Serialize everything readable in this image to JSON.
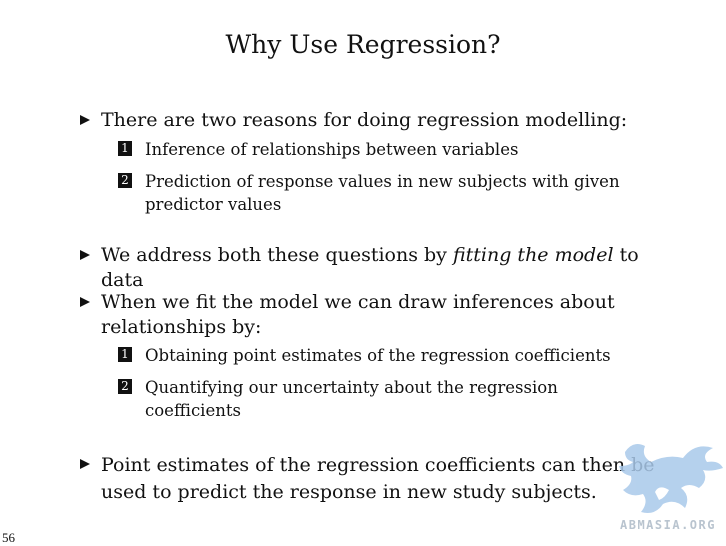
{
  "slide": {
    "title": "Why Use Regression?",
    "page_number": "56"
  },
  "bullets": [
    {
      "text": "There are two reasons for doing regression modelling:",
      "subitems": [
        {
          "num": "1",
          "text": "Inference of relationships between variables"
        },
        {
          "num": "2",
          "text": "Prediction of response values in new subjects with given predictor values"
        }
      ]
    },
    {
      "text_before": "We address both these questions by ",
      "text_italic": "fitting the model",
      "text_after": " to data"
    },
    {
      "text": "When we fit the model we can draw inferences about relationships by:",
      "subitems": [
        {
          "num": "1",
          "text": "Obtaining point estimates of the regression coefficients"
        },
        {
          "num": "2",
          "text": "Quantifying our uncertainty about the regression coefficients"
        }
      ]
    },
    {
      "text": "Point estimates of the regression coefficients can then be used to predict the response in new study subjects."
    }
  ],
  "watermark": {
    "text": "ABMASIA.ORG",
    "color": "#a9c9ea"
  }
}
